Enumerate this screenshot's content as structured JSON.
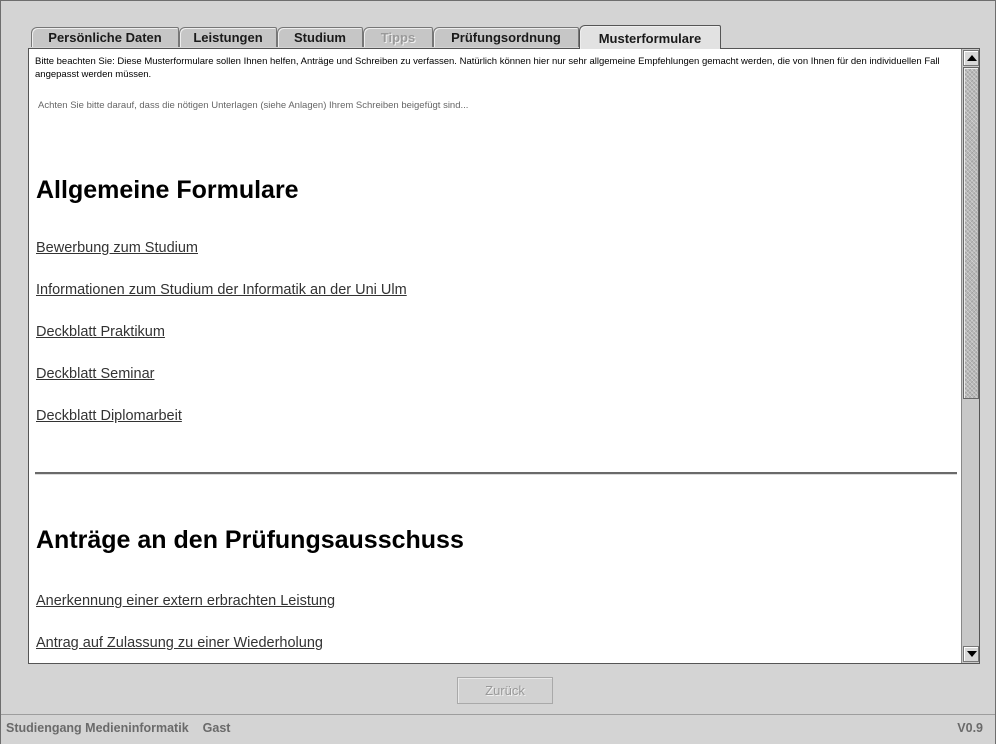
{
  "tabs": [
    {
      "label": "Persönliche Daten",
      "state": "normal"
    },
    {
      "label": "Leistungen",
      "state": "normal"
    },
    {
      "label": "Studium",
      "state": "normal"
    },
    {
      "label": "Tipps",
      "state": "disabled"
    },
    {
      "label": "Prüfungsordnung",
      "state": "normal"
    },
    {
      "label": "Musterformulare",
      "state": "selected"
    }
  ],
  "content": {
    "intro_line1": "Bitte beachten Sie: Diese Musterformulare sollen Ihnen helfen, Anträge und Schreiben zu verfassen. Natürlich können hier nur sehr allgemeine Empfehlungen gemacht werden, die von Ihnen für den individuellen Fall angepasst werden müssen.",
    "intro_line2": "Achten Sie bitte darauf, dass die nötigen Unterlagen (siehe Anlagen) Ihrem Schreiben beigefügt sind...",
    "section1": {
      "heading": "Allgemeine Formulare",
      "links": [
        "Bewerbung zum Studium",
        "Informationen zum Studium der Informatik an der Uni Ulm",
        "Deckblatt Praktikum",
        "Deckblatt Seminar",
        "Deckblatt Diplomarbeit"
      ]
    },
    "section2": {
      "heading": "Anträge an den Prüfungsausschuss",
      "links": [
        "Anerkennung einer extern erbrachten Leistung",
        "Antrag auf Zulassung zu einer Wiederholung"
      ]
    }
  },
  "buttons": {
    "back_label": "Zurück",
    "back_enabled": false
  },
  "status": {
    "program": "Studiengang Medieninformatik",
    "user": "Gast",
    "version": "V0.9"
  },
  "scrollbar": {
    "position_fraction": 0.0,
    "visible_fraction": 0.57
  }
}
